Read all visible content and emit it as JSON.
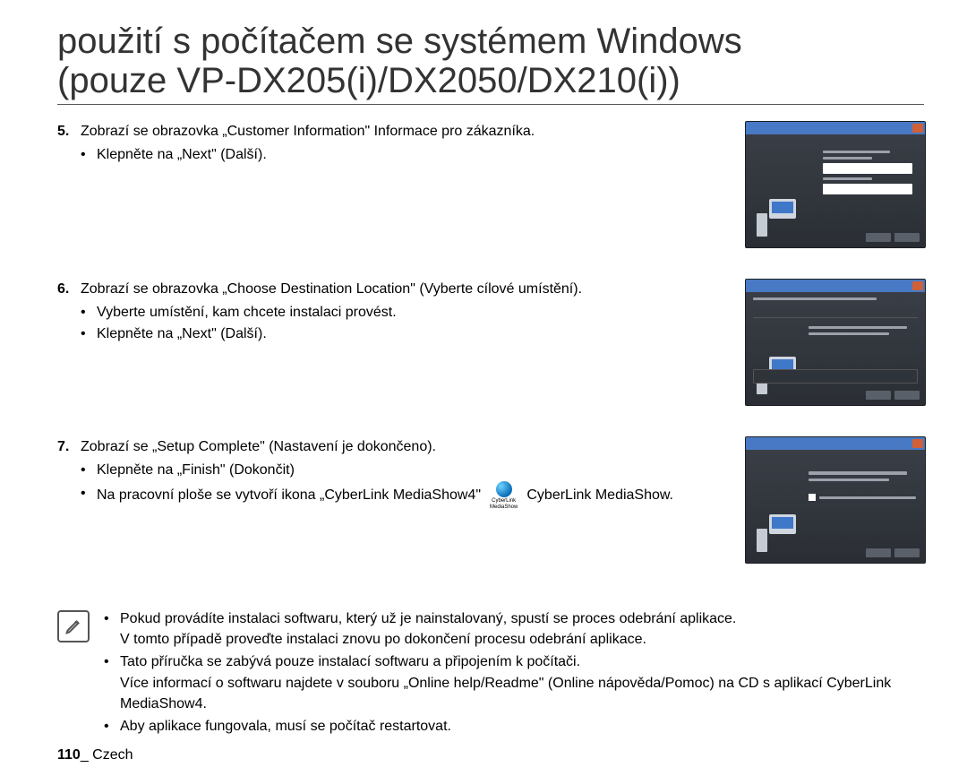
{
  "title_line1": "použití s počítačem se systémem Windows",
  "title_line2": "(pouze VP-DX205(i)/DX2050/DX210(i))",
  "steps": {
    "5": {
      "num": "5.",
      "text": "Zobrazí se obrazovka „Customer Information\" Informace pro zákazníka.",
      "bullets": [
        "Klepněte na „Next\" (Další)."
      ]
    },
    "6": {
      "num": "6.",
      "text": "Zobrazí se obrazovka „Choose Destination Location\" (Vyberte cílové umístění).",
      "bullets": [
        "Vyberte umístění, kam chcete instalaci provést.",
        "Klepněte na „Next\" (Další)."
      ]
    },
    "7": {
      "num": "7.",
      "text": "Zobrazí se „Setup Complete\" (Nastavení je dokončeno).",
      "bullets_a": "Klepněte na „Finish\" (Dokončit)",
      "bullets_b_pre": "Na pracovní ploše se vytvoří ikona „CyberLink MediaShow4\"",
      "bullets_b_post": "CyberLink MediaShow.",
      "icon_label_top": "CyberLink",
      "icon_label_bottom": "MediaShow"
    }
  },
  "notes": {
    "a_line1": "Pokud provádíte instalaci softwaru, který už je nainstalovaný, spustí se proces odebrání aplikace.",
    "a_line2": "V tomto případě proveďte instalaci znovu po dokončení procesu odebrání aplikace.",
    "b_line1": "Tato příručka se zabývá pouze instalací softwaru a připojením k počítači.",
    "b_line2": "Více informací o softwaru najdete v souboru „Online help/Readme\" (Online nápověda/Pomoc) na CD s aplikací CyberLink MediaShow4.",
    "c": "Aby aplikace fungovala, musí se počítač restartovat."
  },
  "footer": {
    "page": "110",
    "sep": "_ ",
    "lang": "Czech"
  }
}
